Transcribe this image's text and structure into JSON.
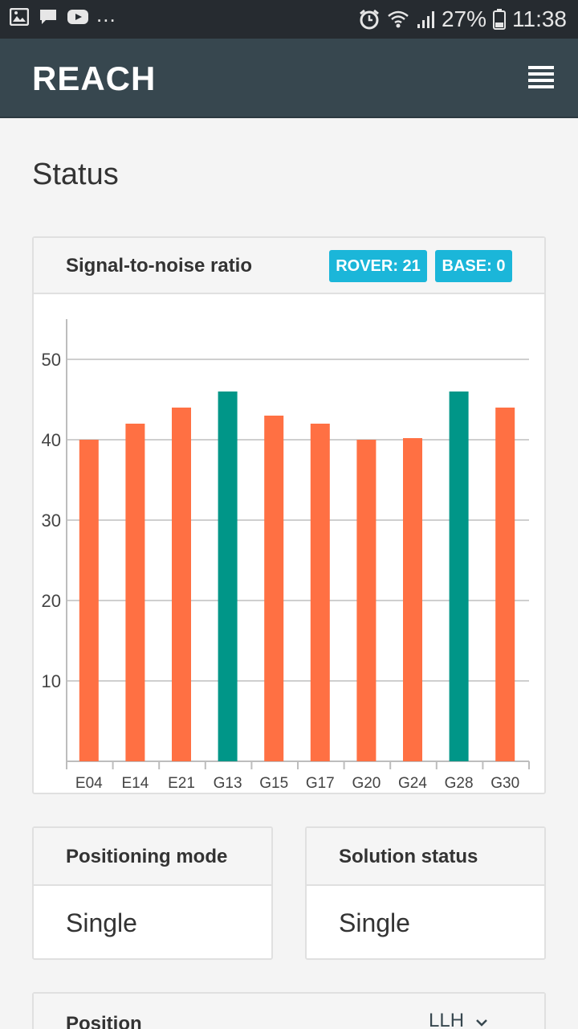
{
  "status_bar": {
    "overflow": "...",
    "battery_percent": "27%",
    "time": "11:38",
    "icons": [
      "image-icon",
      "chat-icon",
      "youtube-icon",
      "alarm-icon",
      "wifi-icon",
      "signal-icon",
      "battery-icon"
    ]
  },
  "appbar": {
    "brand": "REACH",
    "menu_icon": "hamburger-menu-icon"
  },
  "page": {
    "title": "Status"
  },
  "snr": {
    "title": "Signal-to-noise ratio",
    "rover_badge": "ROVER: 21",
    "base_badge": "BASE: 0"
  },
  "chart_data": {
    "type": "bar",
    "title": "",
    "xlabel": "",
    "ylabel": "",
    "categories": [
      "E04",
      "E14",
      "E21",
      "G13",
      "G15",
      "G17",
      "G20",
      "G24",
      "G28",
      "G30"
    ],
    "values": [
      40,
      42,
      44,
      46,
      43,
      42,
      40,
      40.2,
      46,
      44
    ],
    "colors": [
      "#ff7043",
      "#ff7043",
      "#ff7043",
      "#009688",
      "#ff7043",
      "#ff7043",
      "#ff7043",
      "#ff7043",
      "#009688",
      "#ff7043"
    ],
    "yticks": [
      10,
      20,
      30,
      40,
      50
    ],
    "ylim": [
      0,
      55
    ],
    "grid": true
  },
  "positioning_mode": {
    "title": "Positioning mode",
    "value": "Single"
  },
  "solution_status": {
    "title": "Solution status",
    "value": "Single"
  },
  "position": {
    "title": "Position",
    "format": "LLH"
  }
}
